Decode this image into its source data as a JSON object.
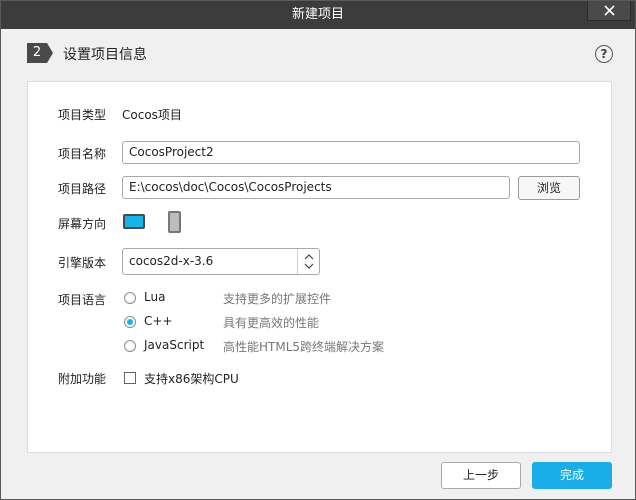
{
  "window": {
    "title": "新建项目"
  },
  "header": {
    "step_number": "2",
    "step_title": "设置项目信息",
    "help_icon": "question-circle-icon"
  },
  "form": {
    "type": {
      "label": "项目类型",
      "value": "Cocos项目"
    },
    "name": {
      "label": "项目名称",
      "value": "CocosProject2"
    },
    "path": {
      "label": "项目路径",
      "value": "E:\\cocos\\doc\\Cocos\\CocosProjects",
      "browse_label": "浏览"
    },
    "orientation": {
      "label": "屏幕方向",
      "selected": "landscape",
      "options": [
        "landscape",
        "portrait"
      ]
    },
    "engine": {
      "label": "引擎版本",
      "selected": "cocos2d-x-3.6"
    },
    "language": {
      "label": "项目语言",
      "selected": "C++",
      "options": [
        {
          "name": "Lua",
          "desc": "支持更多的扩展控件"
        },
        {
          "name": "C++",
          "desc": "具有更高效的性能"
        },
        {
          "name": "JavaScript",
          "desc": "高性能HTML5跨终端解决方案"
        }
      ]
    },
    "extras": {
      "label": "附加功能",
      "x86_label": "支持x86架构CPU",
      "x86_checked": false
    }
  },
  "footer": {
    "prev_label": "上一步",
    "done_label": "完成"
  },
  "colors": {
    "accent": "#19aee8",
    "titlebar": "#3c3c3c",
    "step_badge": "#4a4a4a"
  }
}
